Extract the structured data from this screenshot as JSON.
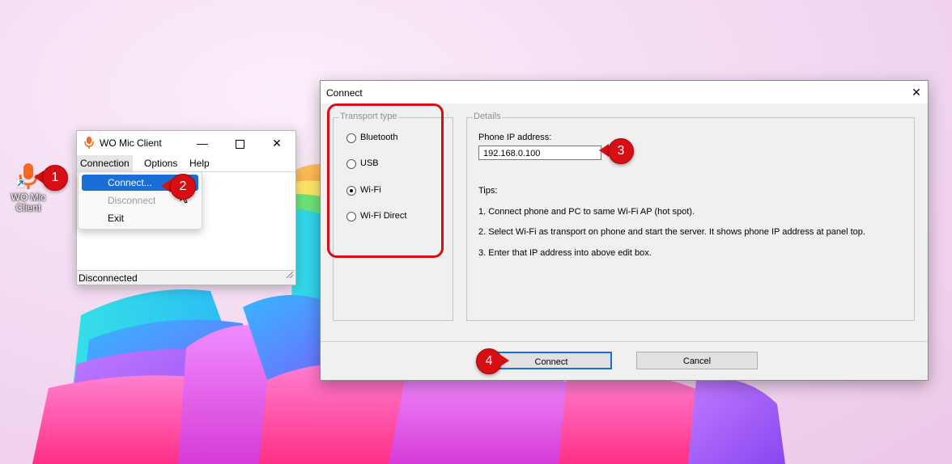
{
  "desktop": {
    "shortcut_label_line1": "WO Mic",
    "shortcut_label_line2": "Client"
  },
  "wo_mic_window": {
    "title": "WO Mic Client",
    "menu": [
      "Connection",
      "Options",
      "Help"
    ],
    "status": "Disconnected",
    "connection_menu": {
      "items": [
        {
          "label": "Connect...",
          "state": "highlighted"
        },
        {
          "label": "Disconnect",
          "state": "disabled"
        },
        {
          "label": "Exit",
          "state": "normal"
        }
      ]
    }
  },
  "connect_dialog": {
    "title": "Connect",
    "transport_group_label": "Transport type",
    "transport_options": [
      {
        "label": "Bluetooth",
        "selected": false
      },
      {
        "label": "USB",
        "selected": false
      },
      {
        "label": "Wi-Fi",
        "selected": true
      },
      {
        "label": "Wi-Fi Direct",
        "selected": false
      }
    ],
    "details_group_label": "Details",
    "ip_label": "Phone IP address:",
    "ip_value": "192.168.0.100",
    "tips_heading": "Tips:",
    "tips": [
      "1. Connect phone and PC to same Wi-Fi AP (hot spot).",
      "2. Select Wi-Fi as transport on phone and start the server. It shows phone IP address at panel top.",
      "3. Enter that IP address into above edit box."
    ],
    "connect_button": "Connect",
    "cancel_button": "Cancel"
  },
  "annotations": {
    "steps": [
      "1",
      "2",
      "3",
      "4"
    ],
    "badge_color": "#d70f15"
  },
  "colors": {
    "menu_highlight": "#1a6fd6",
    "disabled_text": "#9a9a9a"
  }
}
